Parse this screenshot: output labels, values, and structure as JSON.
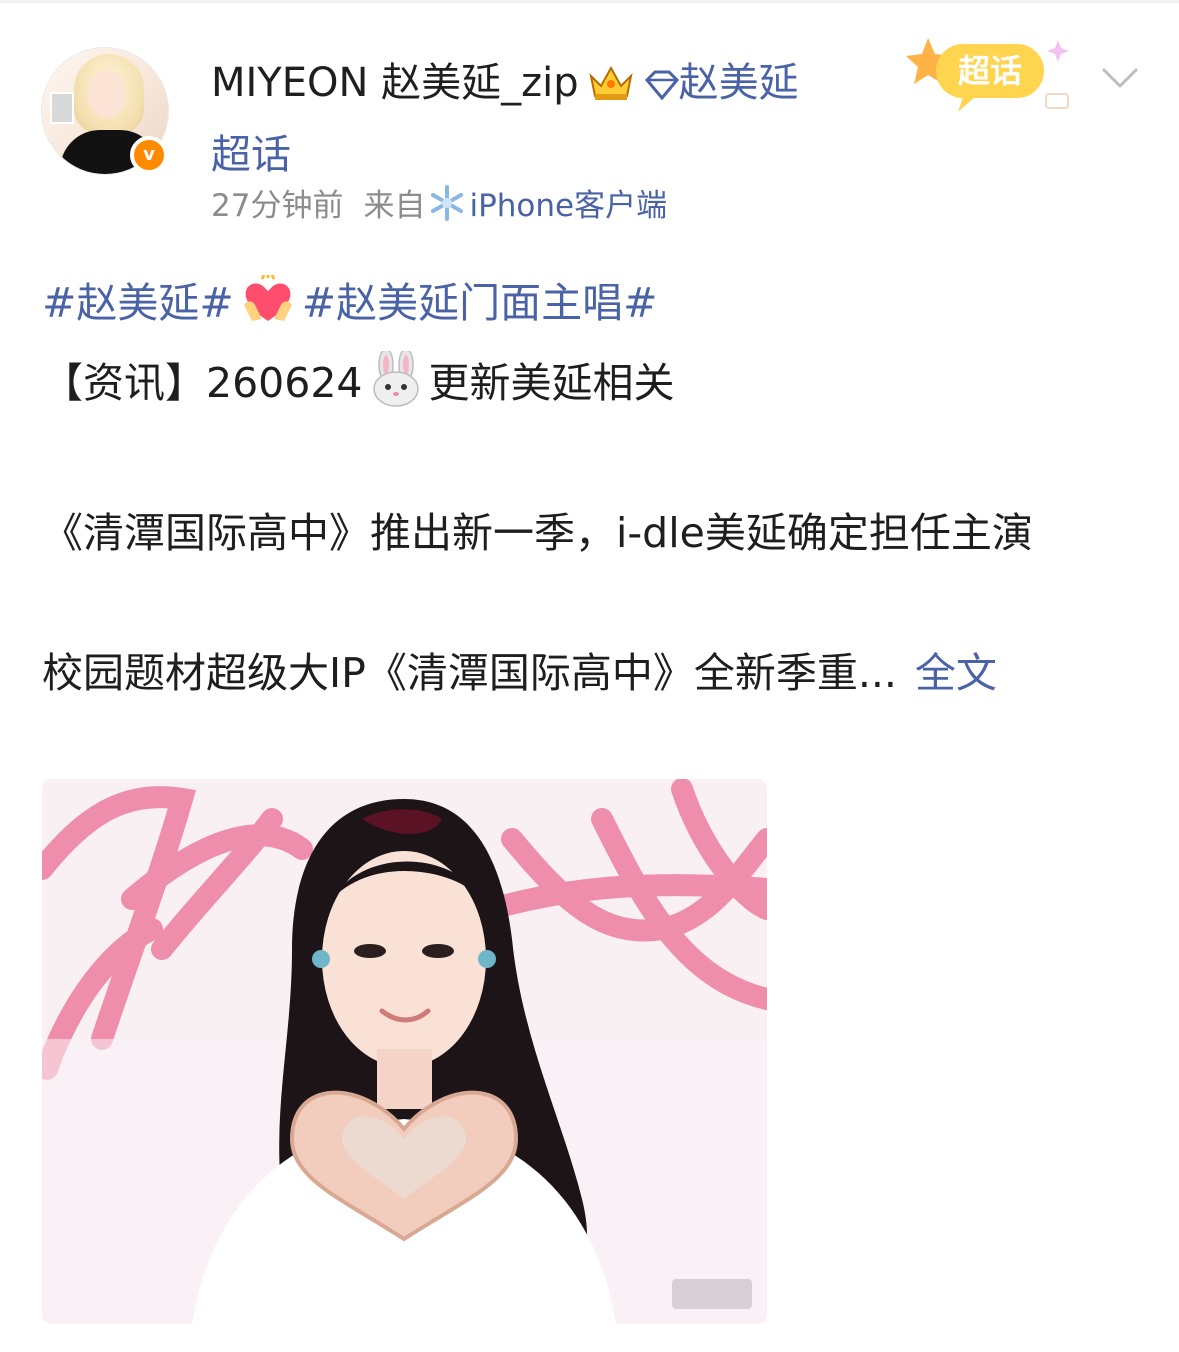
{
  "post": {
    "username": "MIYEON 赵美延_zip",
    "topic_link": "赵美延超话",
    "time": "27分钟前",
    "source_prefix": "来自",
    "client": "iPhone客户端",
    "supertopic_badge": "超话",
    "hashtag_1": "#赵美延#",
    "hashtag_2": "#赵美延门面主唱#",
    "info_line_prefix": "【资讯】260624",
    "info_line_suffix": "更新美延相关",
    "paragraph_1": "《清潭国际高中》推出新一季，i-dle美延确定担任主演",
    "paragraph_2": "校园题材超级大IP《清潭国际高中》全新季重...",
    "expand_label": "全文"
  },
  "icons": {
    "verified": "verified-badge-icon",
    "crown": "crown-icon",
    "diamond": "diamond-icon",
    "snowflake": "snowflake-icon",
    "heart_hands": "heart-hands-emoji",
    "rabbit": "rabbit-face-emoji",
    "chevron": "chevron-down-icon"
  },
  "colors": {
    "link": "#4a63a6",
    "meta": "#8c8c8c",
    "verified": "#ff8a00",
    "badge": "#ffd44f"
  }
}
